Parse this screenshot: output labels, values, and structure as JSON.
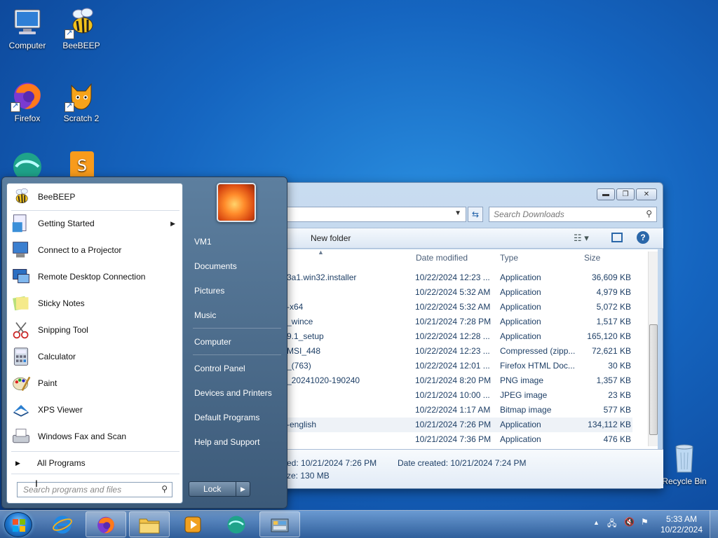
{
  "desktop": {
    "icons": [
      {
        "label": "Computer",
        "icon": "computer-icon"
      },
      {
        "label": "BeeBEEP",
        "icon": "bee-icon"
      },
      {
        "label": "Firefox",
        "icon": "firefox-icon"
      },
      {
        "label": "Scratch 2",
        "icon": "scratch-icon"
      },
      {
        "label": "Recycle Bin",
        "icon": "recycle-bin-icon"
      }
    ]
  },
  "explorer": {
    "search_placeholder": "Search Downloads",
    "new_folder": "New folder",
    "columns": {
      "date": "Date modified",
      "type": "Type",
      "size": "Size"
    },
    "rows": [
      {
        "name": "3a1.win32.installer",
        "date": "10/22/2024 12:23 ...",
        "type": "Application",
        "size": "36,609 KB"
      },
      {
        "name": "",
        "date": "10/22/2024 5:32 AM",
        "type": "Application",
        "size": "4,979 KB"
      },
      {
        "name": "-x64",
        "date": "10/22/2024 5:32 AM",
        "type": "Application",
        "size": "5,072 KB"
      },
      {
        "name": "_wince",
        "date": "10/21/2024 7:28 PM",
        "type": "Application",
        "size": "1,517 KB"
      },
      {
        "name": "9.1_setup",
        "date": "10/22/2024 12:28 ...",
        "type": "Application",
        "size": "165,120 KB"
      },
      {
        "name": "MSI_448",
        "date": "10/22/2024 12:23 ...",
        "type": "Compressed (zipp...",
        "size": "72,621 KB"
      },
      {
        "name": "_(763)",
        "date": "10/22/2024 12:01 ...",
        "type": "Firefox HTML Doc...",
        "size": "30 KB"
      },
      {
        "name": "_20241020-190240",
        "date": "10/21/2024 8:20 PM",
        "type": "PNG image",
        "size": "1,357 KB"
      },
      {
        "name": "",
        "date": "10/21/2024 10:00 ...",
        "type": "JPEG image",
        "size": "23 KB"
      },
      {
        "name": "",
        "date": "10/22/2024 1:17 AM",
        "type": "Bitmap image",
        "size": "577 KB"
      },
      {
        "name": "-english",
        "date": "10/21/2024 7:26 PM",
        "type": "Application",
        "size": "134,112 KB"
      },
      {
        "name": "",
        "date": "10/21/2024 7:36 PM",
        "type": "Application",
        "size": "476 KB"
      }
    ],
    "details": {
      "modified": "ed: 10/21/2024 7:26 PM",
      "created": "Date created: 10/21/2024 7:24 PM",
      "size": "ze: 130 MB"
    }
  },
  "start_menu": {
    "programs": [
      {
        "label": "BeeBEEP",
        "icon": "bee-icon"
      },
      {
        "label": "Getting Started",
        "icon": "getting-started-icon"
      },
      {
        "label": "Connect to a Projector",
        "icon": "projector-icon"
      },
      {
        "label": "Remote Desktop Connection",
        "icon": "remote-desktop-icon"
      },
      {
        "label": "Sticky Notes",
        "icon": "sticky-notes-icon"
      },
      {
        "label": "Snipping Tool",
        "icon": "snipping-tool-icon"
      },
      {
        "label": "Calculator",
        "icon": "calculator-icon"
      },
      {
        "label": "Paint",
        "icon": "paint-icon"
      },
      {
        "label": "XPS Viewer",
        "icon": "xps-viewer-icon"
      },
      {
        "label": "Windows Fax and Scan",
        "icon": "fax-icon"
      }
    ],
    "all_programs": "All Programs",
    "search_placeholder": "Search programs and files",
    "right": [
      "VM1",
      "Documents",
      "Pictures",
      "Music",
      "Computer",
      "Control Panel",
      "Devices and Printers",
      "Default Programs",
      "Help and Support"
    ],
    "lock": "Lock"
  },
  "taskbar": {
    "time": "5:33 AM",
    "date": "10/22/2024"
  }
}
